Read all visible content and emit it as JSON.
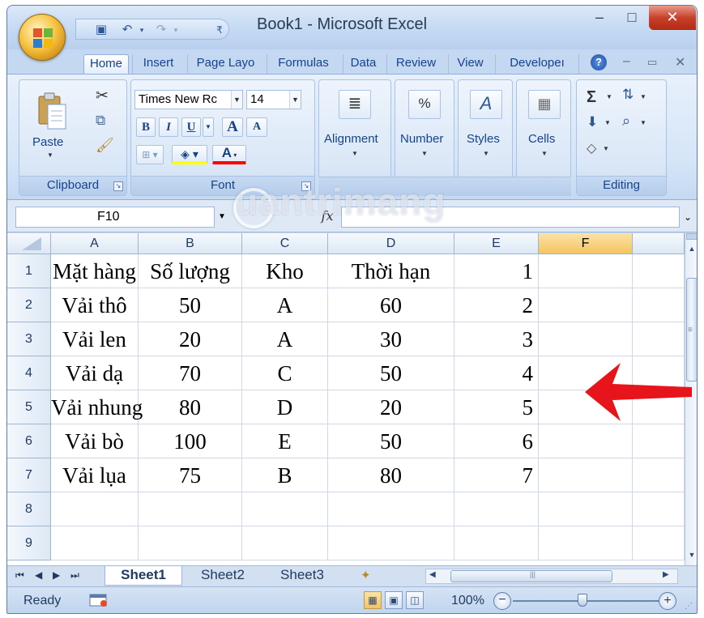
{
  "window": {
    "title": "Book1 - Microsoft Excel",
    "minimize_glyph": "–",
    "maximize_glyph": "□",
    "close_glyph": "✕"
  },
  "ribbon_tabs": [
    "Home",
    "Insert",
    "Page Layo",
    "Formulas",
    "Data",
    "Review",
    "View",
    "Developeı"
  ],
  "ribbon": {
    "clipboard": {
      "label": "Clipboard",
      "paste": "Paste"
    },
    "font": {
      "label": "Font",
      "name": "Times New Rc",
      "size": "14",
      "bold": "B",
      "italic": "I",
      "underline": "U",
      "grow": "A",
      "shrink": "A",
      "font_color": "A"
    },
    "alignment": {
      "label": "Alignment"
    },
    "number": {
      "label": "Number",
      "icon_text": "%"
    },
    "styles": {
      "label": "Styles"
    },
    "cells": {
      "label": "Cells"
    },
    "editing": {
      "label": "Editing",
      "sum": "Σ"
    }
  },
  "formula_bar": {
    "name_box": "F10",
    "fx": "fx",
    "value": ""
  },
  "columns": [
    "A",
    "B",
    "C",
    "D",
    "E",
    "F"
  ],
  "rows": [
    {
      "num": "1",
      "cells": [
        "Mặt hàng",
        "Số lượng",
        "Kho",
        "Thời hạn",
        "1",
        ""
      ]
    },
    {
      "num": "2",
      "cells": [
        "Vải thô",
        "50",
        "A",
        "60",
        "2",
        ""
      ]
    },
    {
      "num": "3",
      "cells": [
        "Vải len",
        "20",
        "A",
        "30",
        "3",
        ""
      ]
    },
    {
      "num": "4",
      "cells": [
        "Vải dạ",
        "70",
        "C",
        "50",
        "4",
        ""
      ]
    },
    {
      "num": "5",
      "cells": [
        "Vải nhung",
        "80",
        "D",
        "20",
        "5",
        ""
      ]
    },
    {
      "num": "6",
      "cells": [
        "Vải bò",
        "100",
        "E",
        "50",
        "6",
        ""
      ]
    },
    {
      "num": "7",
      "cells": [
        "Vải lụa",
        "75",
        "B",
        "80",
        "7",
        ""
      ]
    },
    {
      "num": "8",
      "cells": [
        "",
        "",
        "",
        "",
        "",
        ""
      ]
    },
    {
      "num": "9",
      "cells": [
        "",
        "",
        "",
        "",
        "",
        ""
      ]
    }
  ],
  "selected_column": "F",
  "sheets": [
    "Sheet1",
    "Sheet2",
    "Sheet3"
  ],
  "active_sheet": "Sheet1",
  "status": {
    "ready": "Ready",
    "zoom": "100%"
  },
  "watermark": "uantrimang",
  "colors": {
    "accent": "#15428b",
    "selection": "#f5c460",
    "arrow": "#e8141c"
  }
}
